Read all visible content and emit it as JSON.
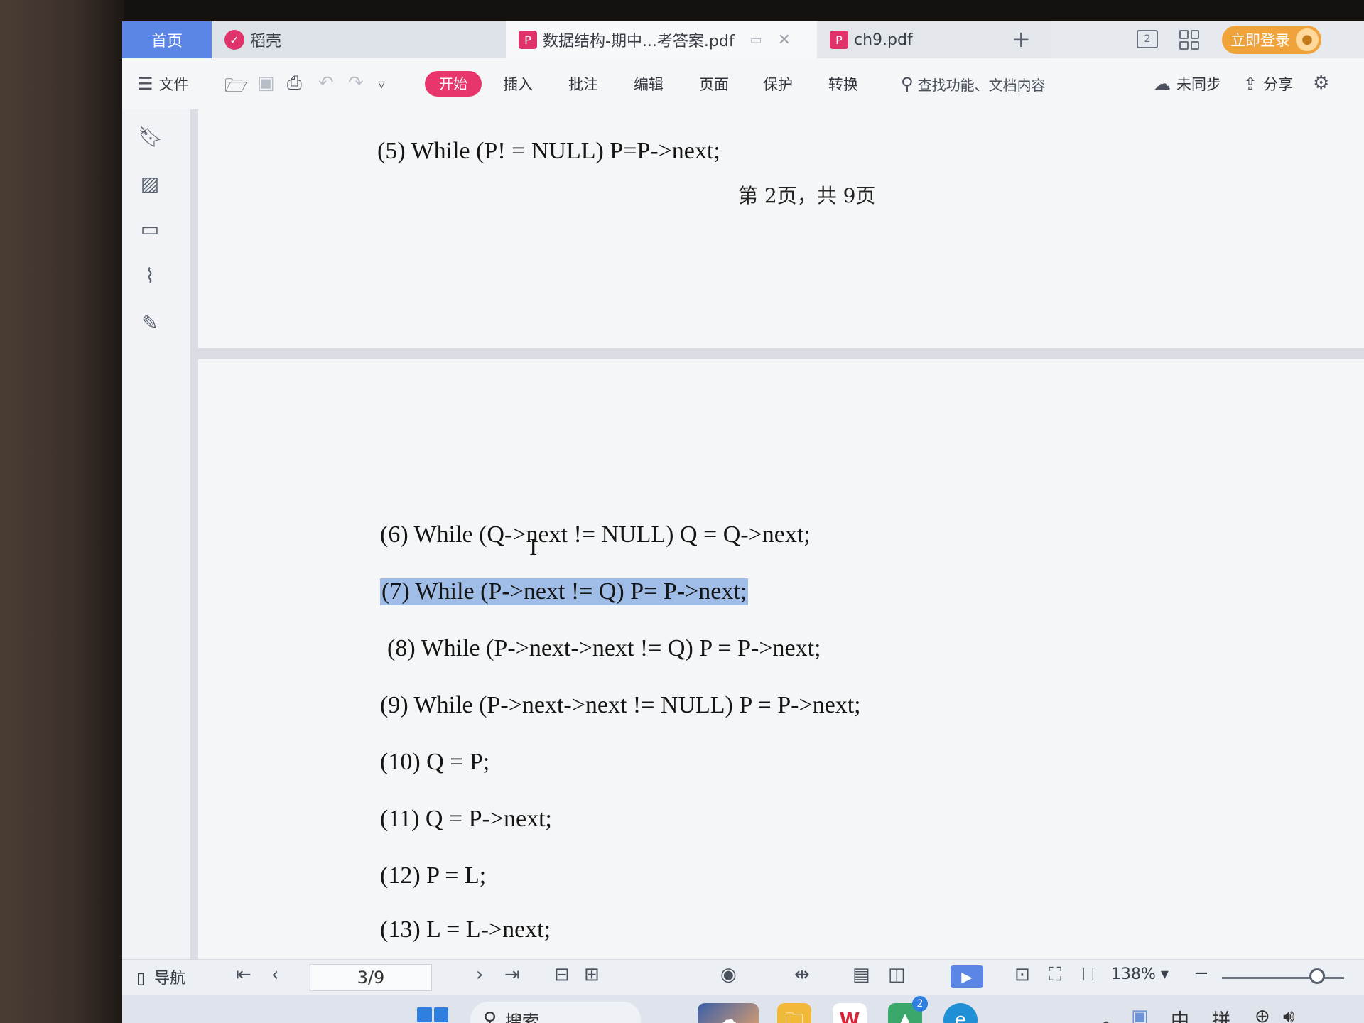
{
  "tabs": {
    "home": "首页",
    "daoke": "稻壳",
    "doc1": "数据结构-期中...考答案.pdf",
    "doc2": "ch9.pdf"
  },
  "titlebar": {
    "login": "立即登录",
    "page_layout_icon_text": "2"
  },
  "ribbon": {
    "file": "文件",
    "start": "开始",
    "insert": "插入",
    "annotate": "批注",
    "edit": "编辑",
    "page": "页面",
    "protect": "保护",
    "convert": "转换",
    "search": "查找功能、文档内容",
    "sync": "未同步",
    "share": "分享"
  },
  "document": {
    "page1_line": "(5) While (P! = NULL) P=P->next;",
    "page_footer": "第 2页，共 9页",
    "lines": [
      "(6) While (Q->next != NULL) Q = Q->next;",
      "(7) While (P->next != Q) P= P->next;",
      "(8) While (P->next->next != Q) P = P->next;",
      "(9) While (P->next->next != NULL) P = P->next;",
      "(10) Q = P;",
      "(11) Q = P->next;",
      "(12) P = L;",
      "(13) L = L->next;"
    ],
    "highlighted_index": 1
  },
  "statusbar": {
    "nav": "导航",
    "page_indicator": "3/9",
    "zoom": "138%",
    "zoom_level": 0.78
  },
  "taskbar": {
    "search": "搜索",
    "badge_count": "2",
    "ime_lang": "中",
    "ime_mode": "拼"
  },
  "colors": {
    "accent": "#5b86e5",
    "start_pill": "#e8356c",
    "highlight": "#9fbde6",
    "login": "#f1a33b"
  }
}
